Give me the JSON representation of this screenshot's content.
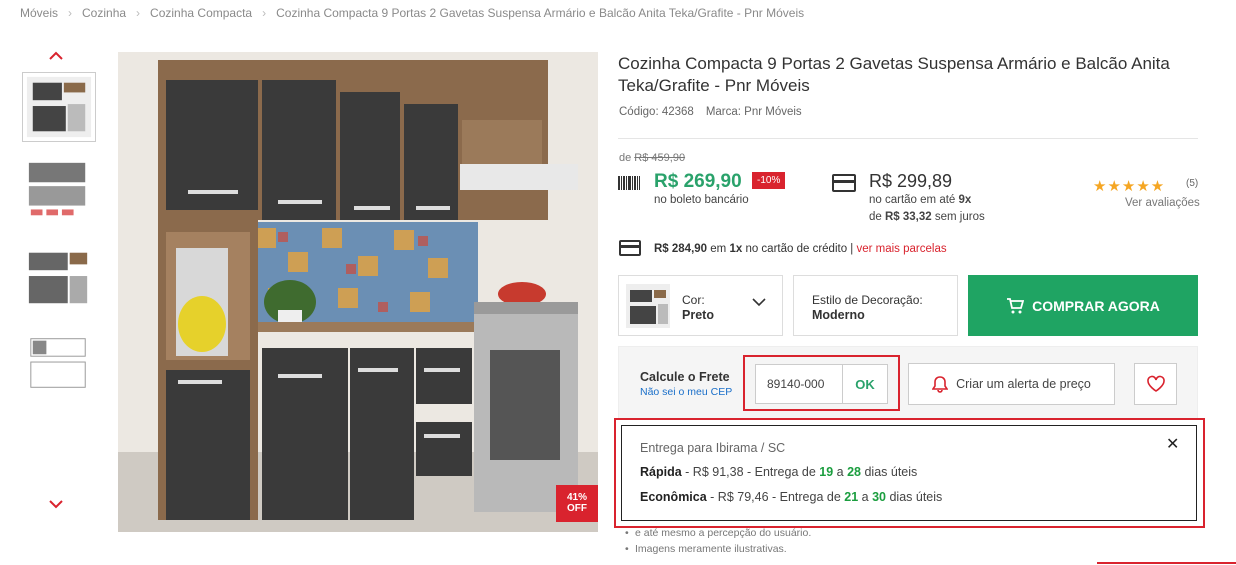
{
  "breadcrumb": [
    "Móveis",
    "Cozinha",
    "Cozinha Compacta",
    "Cozinha Compacta 9 Portas 2 Gavetas Suspensa Armário e Balcão Anita Teka/Grafite - Pnr Móveis"
  ],
  "gallery": {
    "badge_line1": "41%",
    "badge_line2": "OFF"
  },
  "product": {
    "title": "Cozinha Compacta 9 Portas 2 Gavetas Suspensa Armário e Balcão Anita Teka/Grafite - Pnr Móveis",
    "code": "Código: 42368",
    "brand": "Marca: Pnr Móveis"
  },
  "pricing": {
    "from_prefix": "de ",
    "old_price": "R$ 459,90",
    "boleto_price": "R$ 269,90",
    "discount": "-10%",
    "boleto_label": "no boleto bancário",
    "card_price": "R$ 299,89",
    "card_line1_pre": "no cartão em até ",
    "card_installments": "9x",
    "card_line2_pre": "de ",
    "card_installment_value": "R$ 33,32",
    "card_line2_post": " sem juros",
    "credit_price": "R$ 284,90",
    "credit_mid": " em ",
    "credit_times": "1x",
    "credit_post": " no cartão de crédito | ",
    "credit_link": "ver mais parcelas"
  },
  "rating": {
    "stars": "★★★★★",
    "count": "(5)",
    "link": "Ver avaliações"
  },
  "variants": {
    "cor_label": "Cor:",
    "cor_value": "Preto",
    "estilo_label": "Estilo de Decoração:",
    "estilo_value": "Moderno"
  },
  "buy_button": "COMPRAR AGORA",
  "shipping": {
    "title": "Calcule o Frete",
    "cep_link": "Não sei o meu CEP",
    "cep_value": "89140-000",
    "ok": "OK",
    "alert": "Criar um alerta de preço"
  },
  "delivery": {
    "title": "Entrega para Ibirama / SC",
    "close": "✕",
    "options": [
      {
        "name": "Rápida",
        "price": " - R$ 91,38 - Entrega de ",
        "from": "19",
        "mid": " a ",
        "to": "28",
        "suffix": " dias úteis"
      },
      {
        "name": "Econômica",
        "price": " - R$ 79,46 - Entrega de ",
        "from": "21",
        "mid": " a ",
        "to": "30",
        "suffix": " dias úteis"
      }
    ]
  },
  "notes": [
    "e até mesmo a percepção do usuário.",
    "Imagens meramente ilustrativas."
  ],
  "colors": {
    "accent_red": "#d9232e",
    "price_green": "#2aa26b",
    "buy_green": "#1fa463"
  }
}
